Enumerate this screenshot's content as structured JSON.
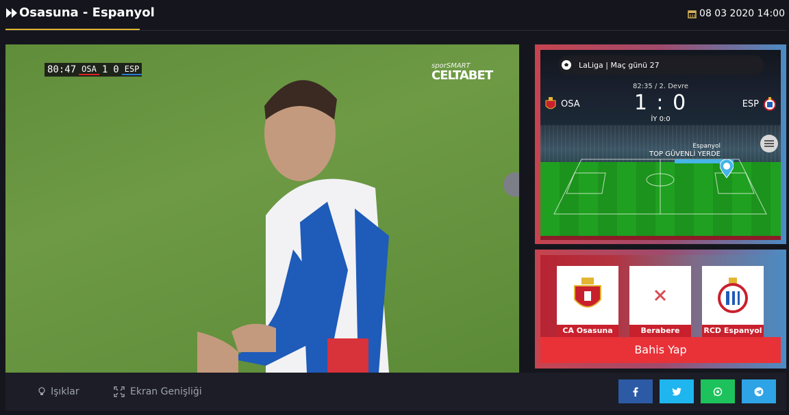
{
  "header": {
    "title": "Osasuna - Espanyol",
    "date": "08 03 2020 14:00"
  },
  "video": {
    "scorebug": {
      "clock": "80:47",
      "home": "OSA",
      "home_score": "1",
      "away_score": "0",
      "away": "ESP"
    },
    "broadcaster_top": "sporSMART",
    "broadcaster_logo": "CELTABET"
  },
  "match_widget": {
    "league": "LaLiga | Maç günü 27",
    "match_time": "82:35 / 2. Devre",
    "score": "1 : 0",
    "half_time": "İY 0:0",
    "home_team": "OSA",
    "away_team": "ESP",
    "event_team": "Espanyol",
    "event_text": "TOP GÜVENLİ YERDE"
  },
  "bet_widget": {
    "options": [
      {
        "label": "CA Osasuna"
      },
      {
        "label": "Berabere"
      },
      {
        "label": "RCD Espanyol"
      }
    ],
    "cta": "Bahis Yap"
  },
  "footer": {
    "lights": "Işıklar",
    "fullscreen": "Ekran Genişliği",
    "share": [
      {
        "icon": "facebook-icon",
        "color": "#2d5aa5"
      },
      {
        "icon": "twitter-icon",
        "color": "#1fb5ef"
      },
      {
        "icon": "whatsapp-icon",
        "color": "#1ec25c"
      },
      {
        "icon": "telegram-icon",
        "color": "#2ea3e6"
      }
    ]
  },
  "colors": {
    "accent": "#e2b533",
    "bet_red": "#e83238",
    "background": "#15161d"
  }
}
